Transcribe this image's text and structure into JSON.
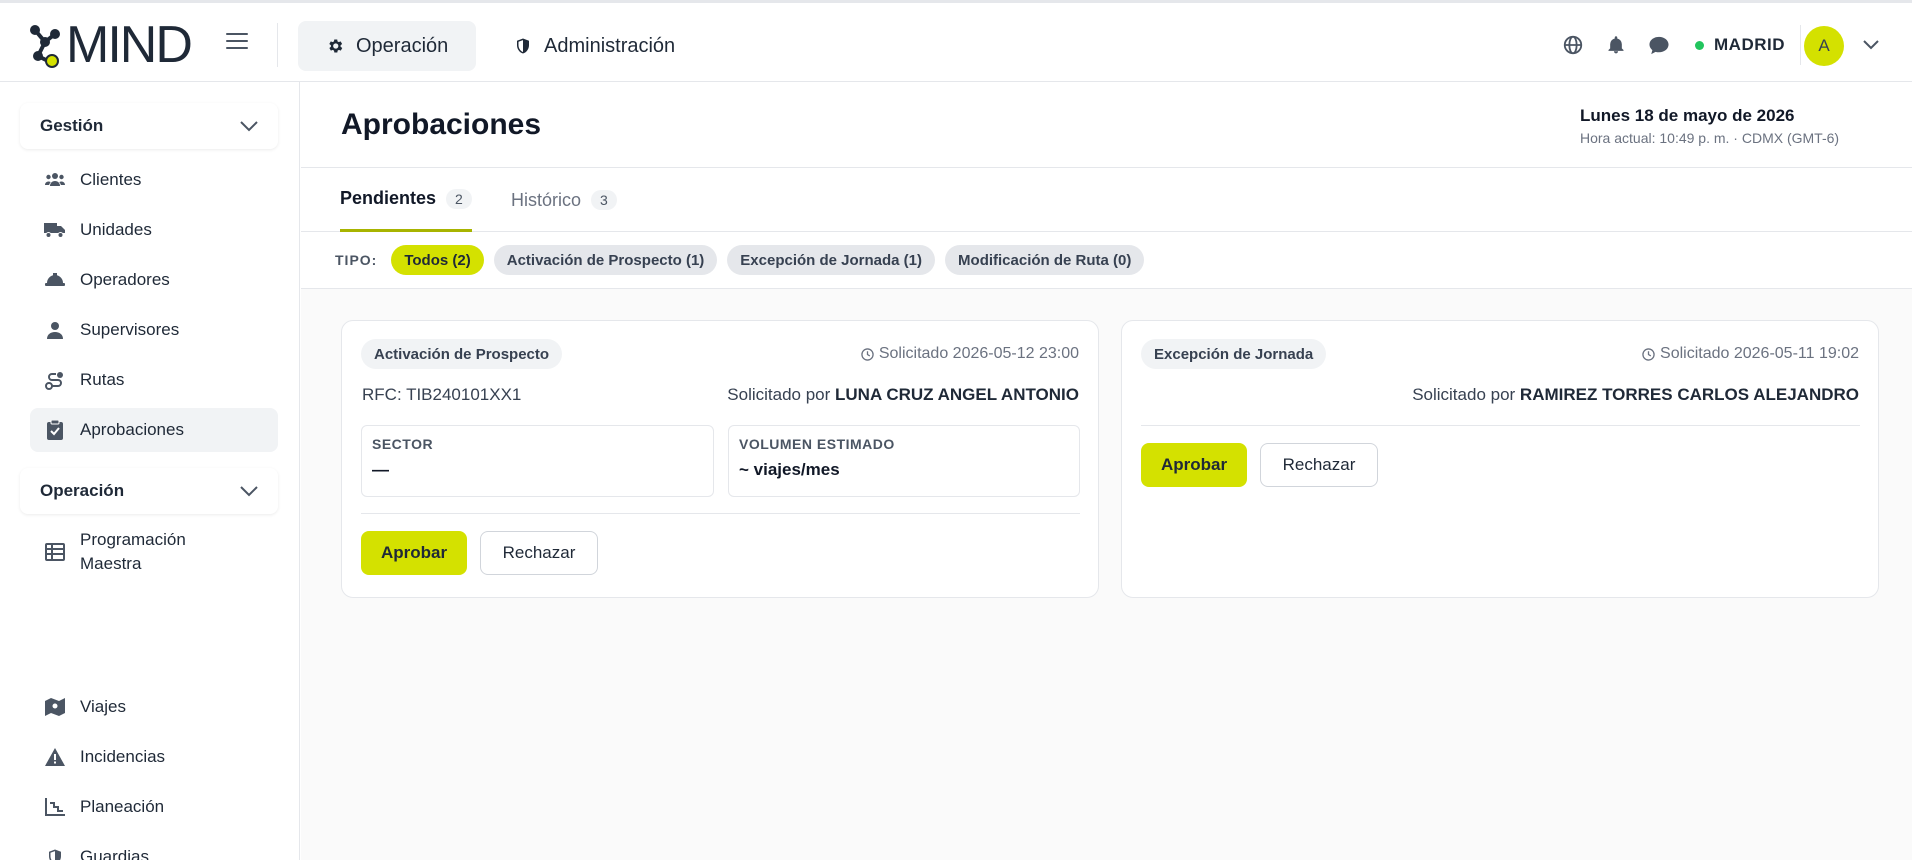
{
  "app": {
    "logo_text": "MIND",
    "brand_color": "#d4e100"
  },
  "nav": {
    "tabs": [
      {
        "label": "Operación",
        "icon": "gear-icon",
        "active": true
      },
      {
        "label": "Administración",
        "icon": "shield-icon",
        "active": false
      }
    ],
    "city": "MADRID",
    "avatar_initial": "A",
    "icons": [
      "globe-icon",
      "bell-icon",
      "chat-icon",
      "chevron-down-icon"
    ]
  },
  "sidebar": {
    "sections": [
      {
        "label": "Gestión",
        "items": [
          {
            "label": "Clientes",
            "icon": "users-icon"
          },
          {
            "label": "Unidades",
            "icon": "truck-icon"
          },
          {
            "label": "Operadores",
            "icon": "hardhat-icon"
          },
          {
            "label": "Supervisores",
            "icon": "supervisor-icon"
          },
          {
            "label": "Rutas",
            "icon": "route-icon"
          },
          {
            "label": "Aprobaciones",
            "icon": "clipboard-check-icon",
            "active": true
          }
        ]
      },
      {
        "label": "Operación",
        "items": [
          {
            "label": "Programación Maestra",
            "icon": "table-icon"
          },
          {
            "label": "Viajes",
            "icon": "map-icon"
          },
          {
            "label": "Incidencias",
            "icon": "warning-icon"
          },
          {
            "label": "Planeación",
            "icon": "chart-icon"
          },
          {
            "label": "Guardias",
            "icon": "shield-icon"
          }
        ]
      }
    ]
  },
  "page": {
    "title": "Aprobaciones",
    "date": "Lunes 18 de mayo de 2026",
    "time": "Hora actual: 10:49 p. m. · CDMX (GMT-6)"
  },
  "tabs": [
    {
      "label": "Pendientes",
      "count": "2",
      "active": true
    },
    {
      "label": "Histórico",
      "count": "3",
      "active": false
    }
  ],
  "filters": {
    "label": "TIPO:",
    "chips": [
      {
        "label": "Todos (2)",
        "active": true
      },
      {
        "label": "Activación de Prospecto (1)",
        "active": false
      },
      {
        "label": "Excepción de Jornada (1)",
        "active": false
      },
      {
        "label": "Modificación de Ruta (0)",
        "active": false
      }
    ]
  },
  "cards": [
    {
      "type": "Activación de Prospecto",
      "requested_at": "Solicitado 2026-05-12 23:00",
      "rfc": "RFC: TIB240101XX1",
      "requested_by_prefix": "Solicitado por",
      "requested_by": "LUNA CRUZ ANGEL ANTONIO",
      "fields": [
        {
          "label": "SECTOR",
          "value": "—"
        },
        {
          "label": "VOLUMEN ESTIMADO",
          "value": "~ viajes/mes"
        }
      ],
      "approve": "Aprobar",
      "reject": "Rechazar"
    },
    {
      "type": "Excepción de Jornada",
      "requested_at": "Solicitado 2026-05-11 19:02",
      "requested_by_prefix": "Solicitado por",
      "requested_by": "RAMIREZ TORRES CARLOS ALEJANDRO",
      "approve": "Aprobar",
      "reject": "Rechazar"
    }
  ]
}
